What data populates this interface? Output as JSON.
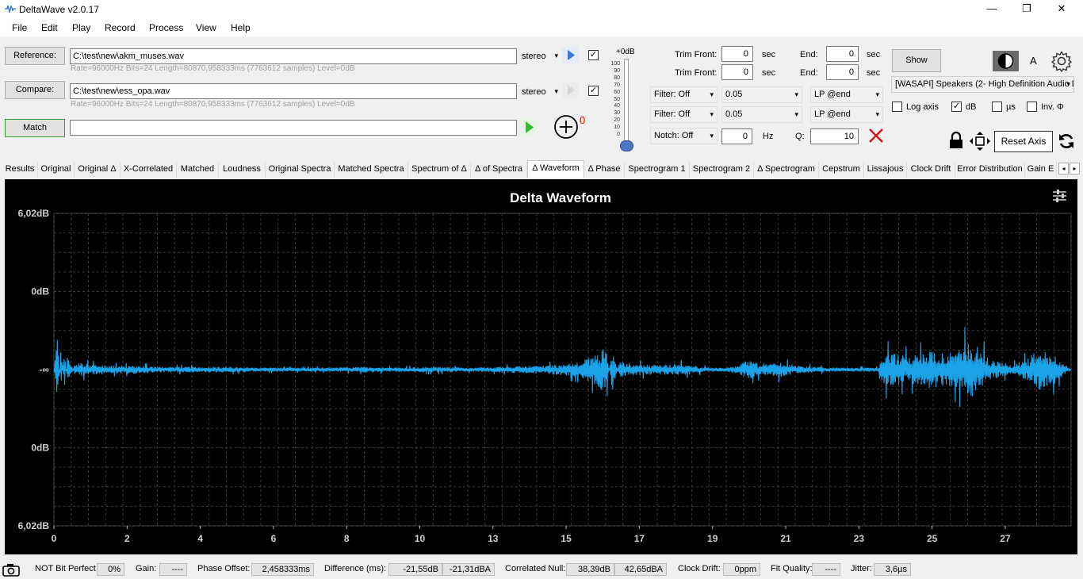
{
  "window": {
    "title": "DeltaWave v2.0.17",
    "minimize": "—",
    "maximize": "❐",
    "close": "✕"
  },
  "menu": [
    "File",
    "Edit",
    "Play",
    "Record",
    "Process",
    "View",
    "Help"
  ],
  "reference": {
    "button": "Reference:",
    "path": "C:\\test\\new\\akm_muses.wav",
    "channel": "stereo",
    "info": "Rate=96000Hz Bits=24 Length=80870,958333ms (7763612 samples) Level=0dB"
  },
  "compare": {
    "button": "Compare:",
    "path": "C:\\test\\new\\ess_opa.wav",
    "channel": "stereo",
    "info": "Rate=96000Hz Bits=24 Length=80870,958333ms (7763612 samples) Level=0dB"
  },
  "match": {
    "button": "Match",
    "value": "",
    "plus_badge": "0"
  },
  "level": {
    "label": "+0dB",
    "ticks": [
      "100",
      "90",
      "80",
      "70",
      "60",
      "50",
      "40",
      "30",
      "20",
      "10",
      "0"
    ]
  },
  "trim": {
    "front_label": "Trim Front:",
    "front1": "0",
    "front2": "0",
    "end_label": "End:",
    "end1": "0",
    "end2": "0",
    "unit": "sec"
  },
  "filters": {
    "filter1": "Filter: Off",
    "filter1_value": "0.05",
    "filter1_lp": "LP @end",
    "filter2": "Filter: Off",
    "filter2_value": "0.05",
    "filter2_lp": "LP @end",
    "notch": "Notch: Off",
    "notch_hz": "0",
    "hz_label": "Hz",
    "q_label": "Q:",
    "q_value": "10"
  },
  "output": {
    "show_button": "Show",
    "a_label": "A",
    "device": "[WASAPI] Speakers (2- High Definition Audio Device)",
    "log_axis": "Log axis",
    "db": "dB",
    "us": "µs",
    "inv": "Inv. Φ",
    "reset_axis": "Reset Axis"
  },
  "tabs": [
    "Results",
    "Original",
    "Original Δ",
    "X-Correlated",
    "Matched",
    "Loudness",
    "Original Spectra",
    "Matched Spectra",
    "Spectrum of Δ",
    "Δ of Spectra",
    "Δ Waveform",
    "Δ Phase",
    "Spectrogram 1",
    "Spectrogram 2",
    "Δ Spectrogram",
    "Cepstrum",
    "Lissajous",
    "Clock Drift",
    "Error Distribution",
    "Gain E"
  ],
  "active_tab": "Δ Waveform",
  "chart_data": {
    "type": "line",
    "title": "Delta Waveform",
    "y_tick_labels": [
      "6,02dB",
      "0dB",
      "-∞",
      "0dB",
      "6,02dB"
    ],
    "x_tick_labels": [
      "0",
      "2",
      "4",
      "6",
      "8",
      "10",
      "13",
      "15",
      "17",
      "19",
      "21",
      "23",
      "25",
      "27"
    ],
    "xlim": [
      0,
      29.5
    ],
    "grid": true,
    "line_color": "#1aa3e8",
    "background": "#000000",
    "series": [
      {
        "points": [
          [
            0,
            0.0
          ],
          [
            0.1,
            0.35
          ],
          [
            0.2,
            -0.2
          ],
          [
            0.3,
            0.2
          ],
          [
            0.4,
            -0.15
          ],
          [
            0.6,
            0.05
          ],
          [
            0.8,
            0.07
          ],
          [
            1.2,
            0.05
          ],
          [
            1.8,
            0.04
          ],
          [
            2.5,
            0.04
          ],
          [
            3.2,
            0.03
          ],
          [
            4.0,
            0.03
          ],
          [
            5.0,
            0.03
          ],
          [
            6.0,
            0.02
          ],
          [
            7.0,
            0.02
          ],
          [
            8.0,
            0.02
          ],
          [
            9.0,
            0.03
          ],
          [
            10.0,
            0.02
          ],
          [
            11.0,
            0.03
          ],
          [
            12.0,
            0.02
          ],
          [
            13.0,
            0.03
          ],
          [
            14.0,
            0.04
          ],
          [
            14.8,
            0.06
          ],
          [
            15.2,
            0.08
          ],
          [
            15.5,
            0.12
          ],
          [
            15.8,
            0.18
          ],
          [
            16.0,
            0.28
          ],
          [
            16.2,
            -0.25
          ],
          [
            16.4,
            0.08
          ],
          [
            16.8,
            0.06
          ],
          [
            17.5,
            0.05
          ],
          [
            18.2,
            0.06
          ],
          [
            18.6,
            0.04
          ],
          [
            19.0,
            0.02
          ],
          [
            19.5,
            0.02
          ],
          [
            19.9,
            0.05
          ],
          [
            20.1,
            0.1
          ],
          [
            20.5,
            0.06
          ],
          [
            21.0,
            0.08
          ],
          [
            21.6,
            0.04
          ],
          [
            22.5,
            0.02
          ],
          [
            23.5,
            0.02
          ],
          [
            23.9,
            0.02
          ],
          [
            24.1,
            0.18
          ],
          [
            24.8,
            0.14
          ],
          [
            25.5,
            0.2
          ],
          [
            26.0,
            0.17
          ],
          [
            26.6,
            0.3
          ],
          [
            27.2,
            0.1
          ],
          [
            27.8,
            0.05
          ],
          [
            28.3,
            0.12
          ],
          [
            28.5,
            0.22
          ],
          [
            29.0,
            0.15
          ],
          [
            29.5,
            0.0
          ]
        ]
      }
    ]
  },
  "status": {
    "bit_perfect_label": "NOT Bit Perfect",
    "bit_perfect_value": "0%",
    "gain_label": "Gain:",
    "gain_value": "----",
    "phase_label": "Phase Offset:",
    "phase_value": "2,458333ms",
    "difference_label": "Difference (ms):",
    "difference_db": "-21,55dB",
    "difference_dba": "-21,31dBA",
    "correlated_label": "Correlated Null:",
    "correlated_db": "38,39dB",
    "correlated_dba": "42,65dBA",
    "clock_label": "Clock Drift:",
    "clock_value": "0ppm",
    "fit_label": "Fit Quality:",
    "fit_value": "----",
    "jitter_label": "Jitter:",
    "jitter_value": "3,6µs"
  }
}
